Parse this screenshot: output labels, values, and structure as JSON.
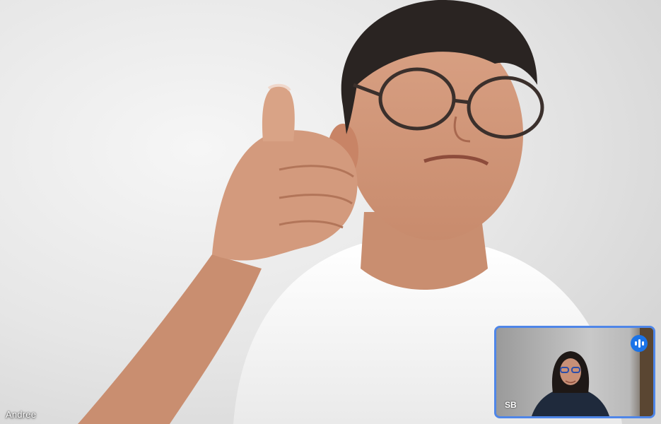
{
  "main_participant": {
    "name": "Andree"
  },
  "self_view": {
    "name": "SB",
    "speaking": true,
    "border_color": "#4f86e8",
    "indicator_color": "#1a73e8",
    "indicator_icon": "audio-level-icon"
  }
}
